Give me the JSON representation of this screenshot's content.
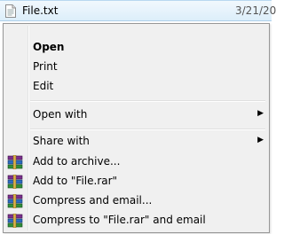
{
  "file_row": {
    "name": "File.txt",
    "date": "3/21/20"
  },
  "menu": {
    "items": [
      {
        "label": "Open",
        "bold": true
      },
      {
        "label": "Print"
      },
      {
        "label": "Edit"
      },
      {
        "label": "Open with",
        "submenu": true
      },
      {
        "label": "Share with",
        "submenu": true
      },
      {
        "label": "Add to archive...",
        "icon": "winrar-icon"
      },
      {
        "label": "Add to \"File.rar\"",
        "icon": "winrar-icon"
      },
      {
        "label": "Compress and email...",
        "icon": "winrar-icon"
      },
      {
        "label": "Compress to \"File.rar\" and email",
        "icon": "winrar-icon"
      }
    ],
    "submenu_glyph": "▶"
  }
}
